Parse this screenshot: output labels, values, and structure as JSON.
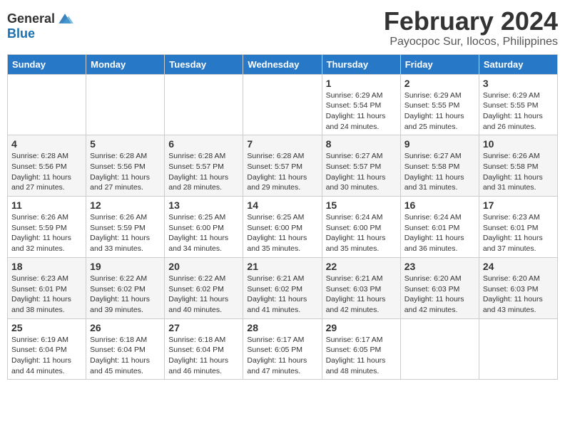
{
  "header": {
    "logo_general": "General",
    "logo_blue": "Blue",
    "title": "February 2024",
    "subtitle": "Payocpoc Sur, Ilocos, Philippines"
  },
  "days_of_week": [
    "Sunday",
    "Monday",
    "Tuesday",
    "Wednesday",
    "Thursday",
    "Friday",
    "Saturday"
  ],
  "weeks": [
    [
      {
        "day": "",
        "info": ""
      },
      {
        "day": "",
        "info": ""
      },
      {
        "day": "",
        "info": ""
      },
      {
        "day": "",
        "info": ""
      },
      {
        "day": "1",
        "info": "Sunrise: 6:29 AM\nSunset: 5:54 PM\nDaylight: 11 hours and 24 minutes."
      },
      {
        "day": "2",
        "info": "Sunrise: 6:29 AM\nSunset: 5:55 PM\nDaylight: 11 hours and 25 minutes."
      },
      {
        "day": "3",
        "info": "Sunrise: 6:29 AM\nSunset: 5:55 PM\nDaylight: 11 hours and 26 minutes."
      }
    ],
    [
      {
        "day": "4",
        "info": "Sunrise: 6:28 AM\nSunset: 5:56 PM\nDaylight: 11 hours and 27 minutes."
      },
      {
        "day": "5",
        "info": "Sunrise: 6:28 AM\nSunset: 5:56 PM\nDaylight: 11 hours and 27 minutes."
      },
      {
        "day": "6",
        "info": "Sunrise: 6:28 AM\nSunset: 5:57 PM\nDaylight: 11 hours and 28 minutes."
      },
      {
        "day": "7",
        "info": "Sunrise: 6:28 AM\nSunset: 5:57 PM\nDaylight: 11 hours and 29 minutes."
      },
      {
        "day": "8",
        "info": "Sunrise: 6:27 AM\nSunset: 5:57 PM\nDaylight: 11 hours and 30 minutes."
      },
      {
        "day": "9",
        "info": "Sunrise: 6:27 AM\nSunset: 5:58 PM\nDaylight: 11 hours and 31 minutes."
      },
      {
        "day": "10",
        "info": "Sunrise: 6:26 AM\nSunset: 5:58 PM\nDaylight: 11 hours and 31 minutes."
      }
    ],
    [
      {
        "day": "11",
        "info": "Sunrise: 6:26 AM\nSunset: 5:59 PM\nDaylight: 11 hours and 32 minutes."
      },
      {
        "day": "12",
        "info": "Sunrise: 6:26 AM\nSunset: 5:59 PM\nDaylight: 11 hours and 33 minutes."
      },
      {
        "day": "13",
        "info": "Sunrise: 6:25 AM\nSunset: 6:00 PM\nDaylight: 11 hours and 34 minutes."
      },
      {
        "day": "14",
        "info": "Sunrise: 6:25 AM\nSunset: 6:00 PM\nDaylight: 11 hours and 35 minutes."
      },
      {
        "day": "15",
        "info": "Sunrise: 6:24 AM\nSunset: 6:00 PM\nDaylight: 11 hours and 35 minutes."
      },
      {
        "day": "16",
        "info": "Sunrise: 6:24 AM\nSunset: 6:01 PM\nDaylight: 11 hours and 36 minutes."
      },
      {
        "day": "17",
        "info": "Sunrise: 6:23 AM\nSunset: 6:01 PM\nDaylight: 11 hours and 37 minutes."
      }
    ],
    [
      {
        "day": "18",
        "info": "Sunrise: 6:23 AM\nSunset: 6:01 PM\nDaylight: 11 hours and 38 minutes."
      },
      {
        "day": "19",
        "info": "Sunrise: 6:22 AM\nSunset: 6:02 PM\nDaylight: 11 hours and 39 minutes."
      },
      {
        "day": "20",
        "info": "Sunrise: 6:22 AM\nSunset: 6:02 PM\nDaylight: 11 hours and 40 minutes."
      },
      {
        "day": "21",
        "info": "Sunrise: 6:21 AM\nSunset: 6:02 PM\nDaylight: 11 hours and 41 minutes."
      },
      {
        "day": "22",
        "info": "Sunrise: 6:21 AM\nSunset: 6:03 PM\nDaylight: 11 hours and 42 minutes."
      },
      {
        "day": "23",
        "info": "Sunrise: 6:20 AM\nSunset: 6:03 PM\nDaylight: 11 hours and 42 minutes."
      },
      {
        "day": "24",
        "info": "Sunrise: 6:20 AM\nSunset: 6:03 PM\nDaylight: 11 hours and 43 minutes."
      }
    ],
    [
      {
        "day": "25",
        "info": "Sunrise: 6:19 AM\nSunset: 6:04 PM\nDaylight: 11 hours and 44 minutes."
      },
      {
        "day": "26",
        "info": "Sunrise: 6:18 AM\nSunset: 6:04 PM\nDaylight: 11 hours and 45 minutes."
      },
      {
        "day": "27",
        "info": "Sunrise: 6:18 AM\nSunset: 6:04 PM\nDaylight: 11 hours and 46 minutes."
      },
      {
        "day": "28",
        "info": "Sunrise: 6:17 AM\nSunset: 6:05 PM\nDaylight: 11 hours and 47 minutes."
      },
      {
        "day": "29",
        "info": "Sunrise: 6:17 AM\nSunset: 6:05 PM\nDaylight: 11 hours and 48 minutes."
      },
      {
        "day": "",
        "info": ""
      },
      {
        "day": "",
        "info": ""
      }
    ]
  ]
}
